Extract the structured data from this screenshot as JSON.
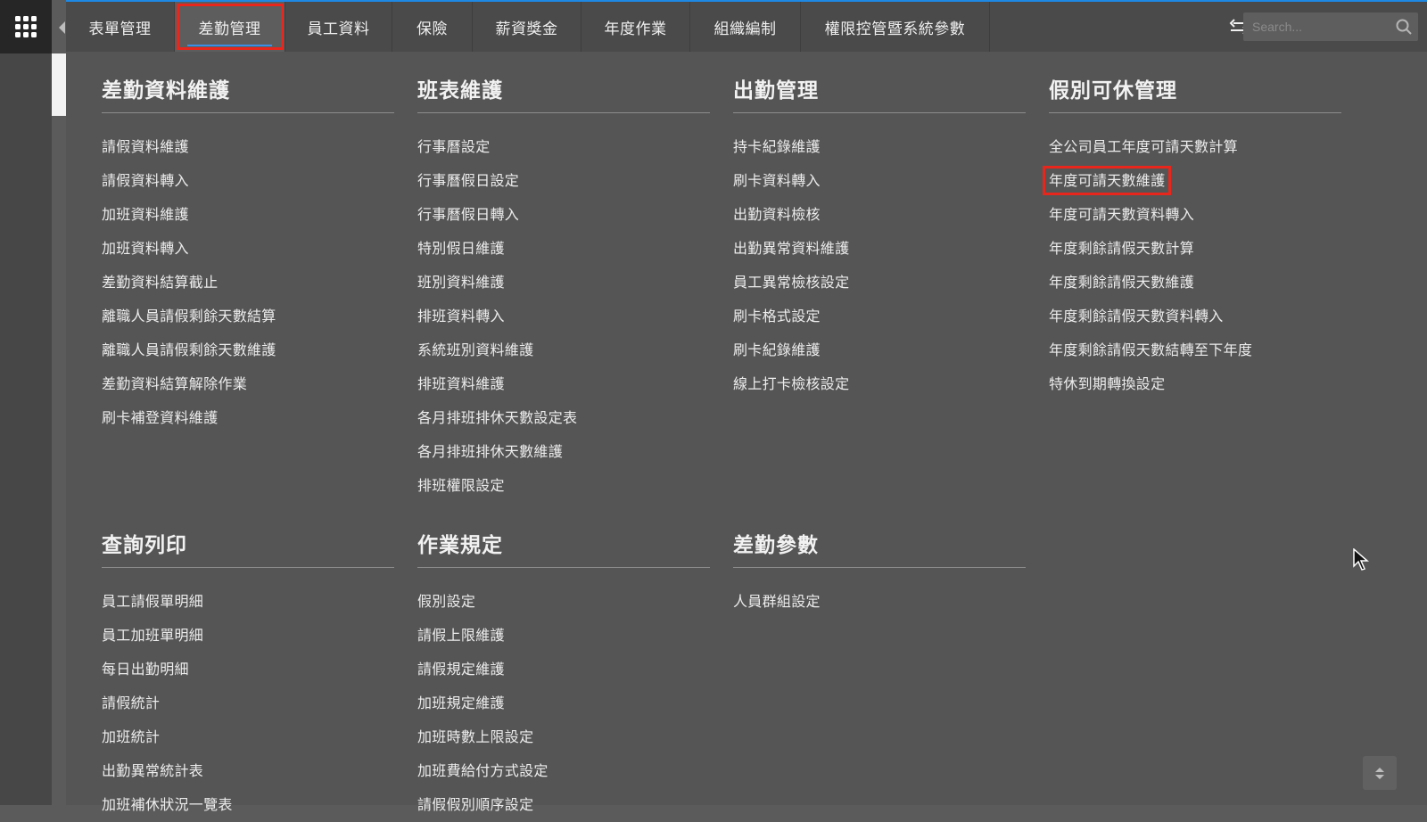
{
  "nav": {
    "tabs": [
      {
        "label": "表單管理"
      },
      {
        "label": "差勤管理"
      },
      {
        "label": "員工資料"
      },
      {
        "label": "保險"
      },
      {
        "label": "薪資獎金"
      },
      {
        "label": "年度作業"
      },
      {
        "label": "組織編制"
      },
      {
        "label": "權限控管暨系統參數"
      }
    ],
    "active_tab": "差勤管理",
    "search_placeholder": "Search..."
  },
  "sections": [
    {
      "title": "差勤資料維護",
      "items": [
        "請假資料維護",
        "請假資料轉入",
        "加班資料維護",
        "加班資料轉入",
        "差勤資料結算截止",
        "離職人員請假剩餘天數結算",
        "離職人員請假剩餘天數維護",
        "差勤資料結算解除作業",
        "刷卡補登資料維護"
      ]
    },
    {
      "title": "班表維護",
      "items": [
        "行事曆設定",
        "行事曆假日設定",
        "行事曆假日轉入",
        "特別假日維護",
        "班別資料維護",
        "排班資料轉入",
        "系統班別資料維護",
        "排班資料維護",
        "各月排班排休天數設定表",
        "各月排班排休天數維護",
        "排班權限設定"
      ]
    },
    {
      "title": "出勤管理",
      "items": [
        "持卡紀錄維護",
        "刷卡資料轉入",
        "出勤資料檢核",
        "出勤異常資料維護",
        "員工異常檢核設定",
        "刷卡格式設定",
        "刷卡紀錄維護",
        "線上打卡檢核設定"
      ]
    },
    {
      "title": "假別可休管理",
      "items": [
        "全公司員工年度可請天數計算",
        "年度可請天數維護",
        "年度可請天數資料轉入",
        "年度剩餘請假天數計算",
        "年度剩餘請假天數維護",
        "年度剩餘請假天數資料轉入",
        "年度剩餘請假天數結轉至下年度",
        "特休到期轉換設定"
      ]
    },
    {
      "title": "查詢列印",
      "items": [
        "員工請假單明細",
        "員工加班單明細",
        "每日出勤明細",
        "請假統計",
        "加班統計",
        "出勤異常統計表",
        "加班補休狀況一覽表"
      ]
    },
    {
      "title": "作業規定",
      "items": [
        "假別設定",
        "請假上限維護",
        "請假規定維護",
        "加班規定維護",
        "加班時數上限設定",
        "加班費給付方式設定",
        "請假假別順序設定"
      ]
    },
    {
      "title": "差勤參數",
      "items": [
        "人員群組設定"
      ]
    }
  ],
  "highlighted_item": "年度可請天數維護",
  "colors": {
    "panel_bg": "#555555",
    "navbar_bg": "#4a4a4a",
    "highlight_red": "#e8261c",
    "accent_blue": "#3a8ee6"
  }
}
